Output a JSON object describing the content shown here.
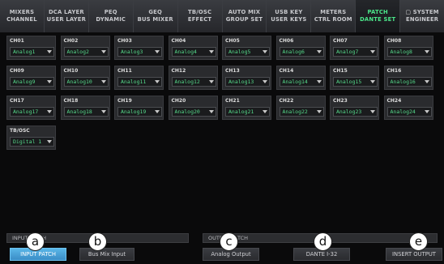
{
  "tabs": [
    {
      "line1": "MIXERS",
      "line2": "CHANNEL",
      "active": false
    },
    {
      "line1": "DCA LAYER",
      "line2": "USER LAYER",
      "active": false
    },
    {
      "line1": "PEQ",
      "line2": "DYNAMIC",
      "active": false
    },
    {
      "line1": "GEQ",
      "line2": "BUS MIXER",
      "active": false
    },
    {
      "line1": "TB/OSC",
      "line2": "EFFECT",
      "active": false
    },
    {
      "line1": "AUTO MIX",
      "line2": "GROUP SET",
      "active": false
    },
    {
      "line1": "USB KEY",
      "line2": "USER KEYS",
      "active": false
    },
    {
      "line1": "METERS",
      "line2": "CTRL ROOM",
      "active": false
    },
    {
      "line1": "PATCH",
      "line2": "DANTE SET",
      "active": true
    },
    {
      "line1": "SYSTEM",
      "line2": "ENGINEER",
      "active": false,
      "icon": "lock-icon"
    }
  ],
  "channels": [
    {
      "name": "CH01",
      "value": "Analog1"
    },
    {
      "name": "CH02",
      "value": "Analog2"
    },
    {
      "name": "CH03",
      "value": "Analog3"
    },
    {
      "name": "CH04",
      "value": "Analog4"
    },
    {
      "name": "CH05",
      "value": "Analog5"
    },
    {
      "name": "CH06",
      "value": "Analog6"
    },
    {
      "name": "CH07",
      "value": "Analog7"
    },
    {
      "name": "CH08",
      "value": "Analog8"
    },
    {
      "name": "CH09",
      "value": "Analog9"
    },
    {
      "name": "CH10",
      "value": "Analog10"
    },
    {
      "name": "CH11",
      "value": "Analog11"
    },
    {
      "name": "CH12",
      "value": "Analog12"
    },
    {
      "name": "CH13",
      "value": "Analog13"
    },
    {
      "name": "CH14",
      "value": "Analog14"
    },
    {
      "name": "CH15",
      "value": "Analog15"
    },
    {
      "name": "CH16",
      "value": "Analog16"
    },
    {
      "name": "CH17",
      "value": "Analog17"
    },
    {
      "name": "CH18",
      "value": "Analog18"
    },
    {
      "name": "CH19",
      "value": "Analog19"
    },
    {
      "name": "CH20",
      "value": "Analog20"
    },
    {
      "name": "CH21",
      "value": "Analog21"
    },
    {
      "name": "CH22",
      "value": "Analog22"
    },
    {
      "name": "CH23",
      "value": "Analog23"
    },
    {
      "name": "CH24",
      "value": "Analog24"
    },
    {
      "name": "TB/OSC",
      "value": "Digital 1"
    }
  ],
  "input_patch": {
    "label": "INPUT PATCH",
    "buttons": [
      {
        "label": "INPUT PATCH",
        "active": true
      },
      {
        "label": "Bus Mix Input",
        "active": false
      }
    ]
  },
  "output_patch": {
    "label": "OUTPUT PATCH",
    "buttons": [
      {
        "label": "Analog Output",
        "active": false
      },
      {
        "label": "DANTE I-32",
        "active": false
      },
      {
        "label": "INSERT OUTPUT",
        "active": false
      }
    ]
  },
  "callouts": [
    "a",
    "b",
    "c",
    "d",
    "e"
  ],
  "colors": {
    "accent_green": "#4be88a",
    "active_button": "#4aa6dd",
    "value_green": "#55d98a"
  }
}
